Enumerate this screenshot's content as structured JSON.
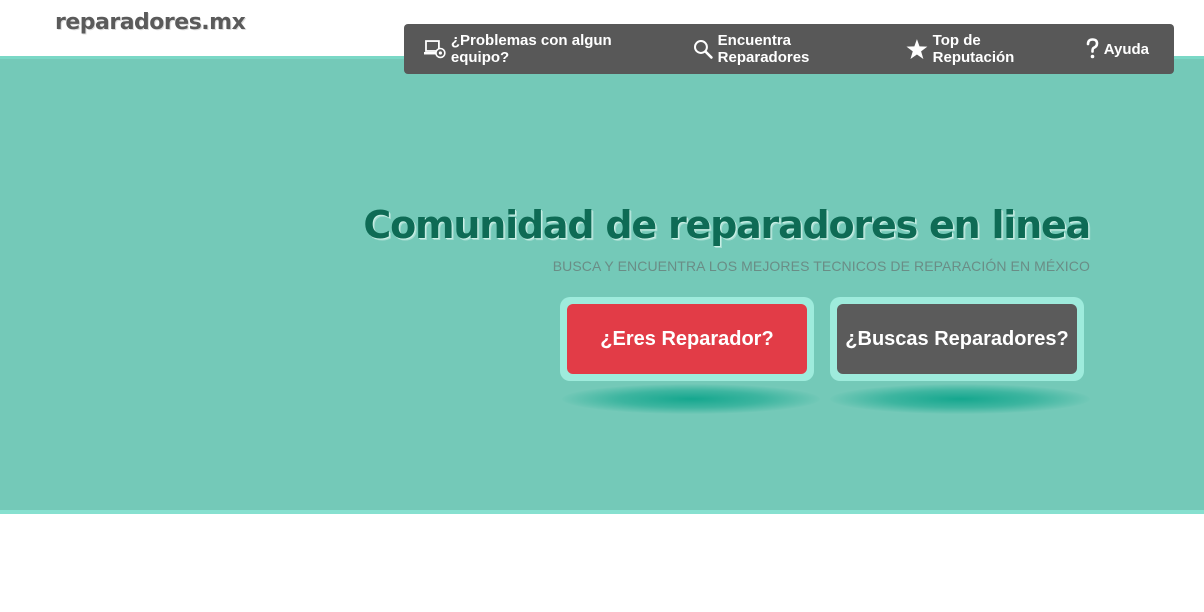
{
  "logo": {
    "text": "reparadores.mx"
  },
  "nav": {
    "items": [
      {
        "label": "¿Problemas con algun equipo?",
        "icon": "laptop-gear-icon"
      },
      {
        "label": "Encuentra Reparadores",
        "icon": "search-icon"
      },
      {
        "label": "Top de Reputación",
        "icon": "star-icon"
      },
      {
        "label": "Ayuda",
        "icon": "question-icon"
      }
    ]
  },
  "hero": {
    "title": "Comunidad de reparadores en linea",
    "subtitle": "BUSCA Y ENCUENTRA LOS MEJORES TECNICOS DE REPARACIÓN EN MÉXICO",
    "buttons": {
      "primary": "¿Eres Reparador?",
      "secondary": "¿Buscas Reparadores?"
    }
  },
  "colors": {
    "hero_bg": "#74c9b8",
    "nav_bg": "#585858",
    "title": "#0e6b55",
    "primary_button": "#e23c47",
    "secondary_button": "#5b5b5b"
  }
}
